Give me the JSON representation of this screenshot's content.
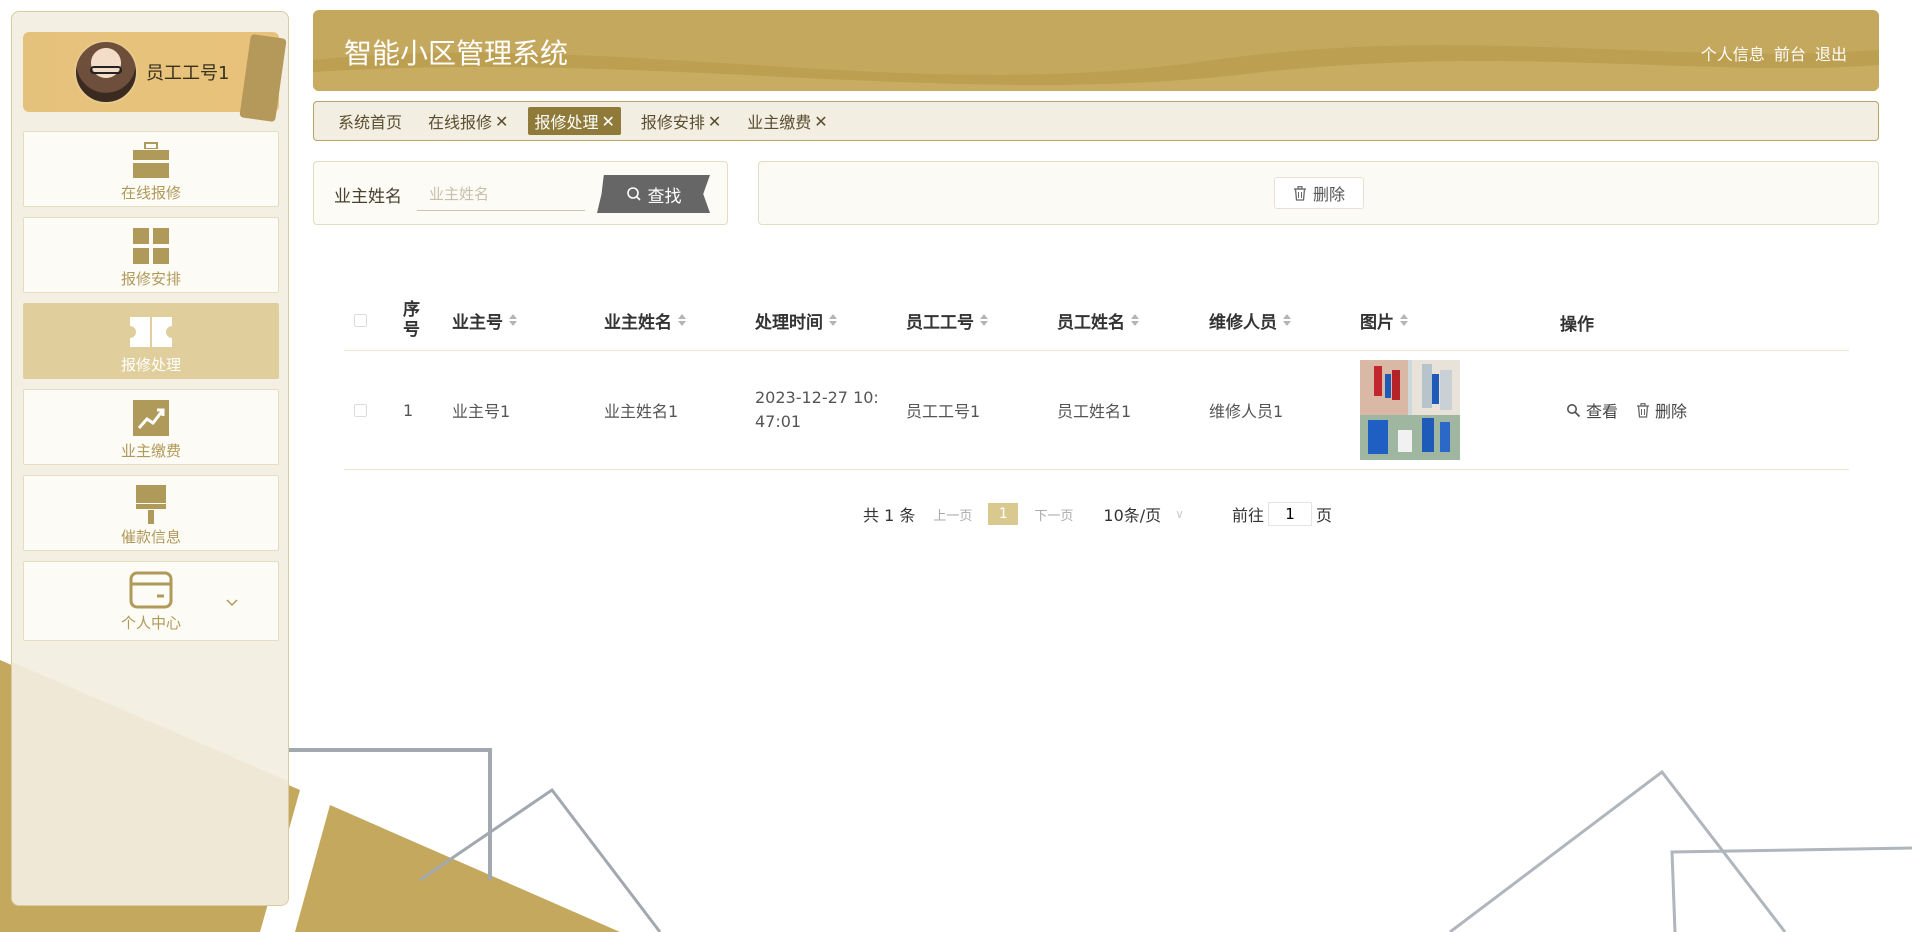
{
  "app": {
    "title": "智能小区管理系统"
  },
  "header": {
    "links": [
      "个人信息",
      "前台",
      "退出"
    ]
  },
  "profile": {
    "name": "员工工号1"
  },
  "sidebar": {
    "items": [
      {
        "label": "在线报修",
        "icon": "briefcase-icon",
        "active": false
      },
      {
        "label": "报修安排",
        "icon": "grid-icon",
        "active": false
      },
      {
        "label": "报修处理",
        "icon": "ticket-icon",
        "active": true
      },
      {
        "label": "业主缴费",
        "icon": "chart-icon",
        "active": false
      },
      {
        "label": "催款信息",
        "icon": "brush-icon",
        "active": false
      },
      {
        "label": "个人中心",
        "icon": "card-icon",
        "active": false
      }
    ]
  },
  "tabs": [
    {
      "label": "系统首页",
      "closable": false,
      "active": false
    },
    {
      "label": "在线报修",
      "closable": true,
      "active": false
    },
    {
      "label": "报修处理",
      "closable": true,
      "active": true
    },
    {
      "label": "报修安排",
      "closable": true,
      "active": false
    },
    {
      "label": "业主缴费",
      "closable": true,
      "active": false
    }
  ],
  "search": {
    "label": "业主姓名",
    "placeholder": "业主姓名",
    "value": "",
    "button": "查找"
  },
  "actions": {
    "delete": "删除"
  },
  "table": {
    "headers": {
      "index": "序号",
      "owner_no": "业主号",
      "owner_name": "业主姓名",
      "time": "处理时间",
      "staff_no": "员工工号",
      "staff_name": "员工姓名",
      "repairer": "维修人员",
      "image": "图片",
      "ops": "操作"
    },
    "rows": [
      {
        "index": "1",
        "owner_no": "业主号1",
        "owner_name": "业主姓名1",
        "time": "2023-12-27 10:47:01",
        "staff_no": "员工工号1",
        "staff_name": "员工姓名1",
        "repairer": "维修人员1"
      }
    ],
    "row_ops": {
      "view": "查看",
      "delete": "删除"
    }
  },
  "pager": {
    "total": "共 1 条",
    "prev": "上一页",
    "current": "1",
    "next": "下一页",
    "size": "10条/页",
    "goto_prefix": "前往",
    "goto_value": "1",
    "goto_suffix": "页"
  },
  "colors": {
    "accent": "#c4a85e",
    "active_tab": "#8f7a3a",
    "active_menu": "#e0cf9c",
    "menu_label": "#b09a5a"
  }
}
